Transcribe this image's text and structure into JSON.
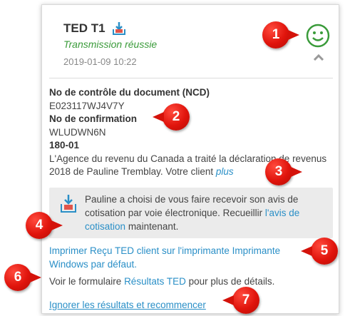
{
  "header": {
    "title": "TED T1",
    "status": "Transmission réussie",
    "datetime": "2019-01-09 10:22",
    "status_color": "#3a9b3a",
    "icons": [
      "inbox-tray-icon",
      "smiley-icon",
      "chevron-up-icon"
    ]
  },
  "details": {
    "ncd_label": "No de contrôle du document (NCD)",
    "ncd_value": "E023117WJ4V7Y",
    "confirmation_label": "No de confirmation",
    "confirmation_value": "WLUDWN6N",
    "code": "180-01",
    "message": "L'Agence du revenu du Canada a traité la déclaration de revenus 2018 de Pauline Tremblay. Votre client",
    "more_link": "plus"
  },
  "notice": {
    "text_before": "Pauline a choisi de vous faire recevoir son avis de cotisation par voie électronique. Recueillir",
    "link": "l'avis de cotisation",
    "text_after": "maintenant."
  },
  "actions": {
    "print_link": "Imprimer Reçu TED client sur l'imprimante Imprimante Windows par défaut.",
    "see_before": "Voir le formulaire",
    "see_link": "Résultats TED",
    "see_after": "pour plus de détails.",
    "restart_link": "Ignorer les résultats et recommencer"
  },
  "callouts": [
    "1",
    "2",
    "3",
    "4",
    "5",
    "6",
    "7"
  ],
  "colors": {
    "link": "#2a8fc7",
    "callout": "#e0140c",
    "notice_bg": "#ebebeb"
  }
}
